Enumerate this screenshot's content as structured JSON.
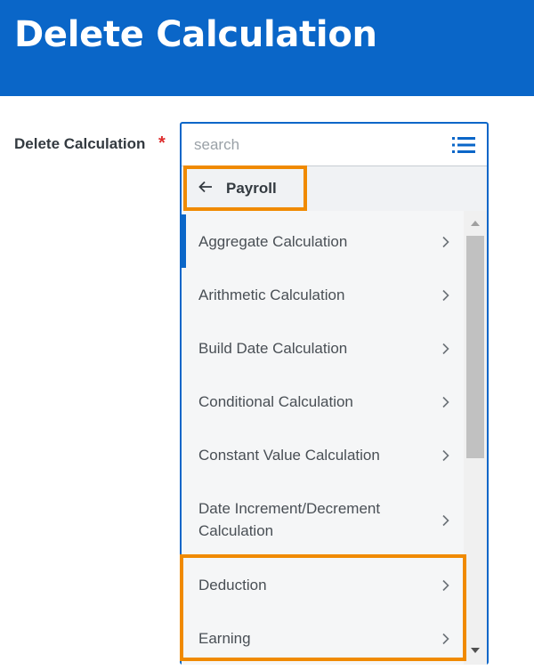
{
  "header": {
    "title": "Delete Calculation"
  },
  "field": {
    "label": "Delete Calculation",
    "required_mark": "*",
    "search_placeholder": "search"
  },
  "back": {
    "label": "Payroll"
  },
  "items": [
    {
      "label": "Aggregate Calculation"
    },
    {
      "label": "Arithmetic Calculation"
    },
    {
      "label": "Build Date Calculation"
    },
    {
      "label": "Conditional Calculation"
    },
    {
      "label": "Constant Value Calculation"
    },
    {
      "label": "Date Increment/Decrement Calculation"
    },
    {
      "label": "Deduction"
    },
    {
      "label": "Earning"
    }
  ],
  "colors": {
    "header_blue": "#0a66c8",
    "highlight_orange": "#f08a00",
    "required_red": "#de2c2c"
  },
  "icons": {
    "prompt_list": "list-icon",
    "back": "arrow-left-icon",
    "item_chevron": "chevron-right-icon"
  }
}
